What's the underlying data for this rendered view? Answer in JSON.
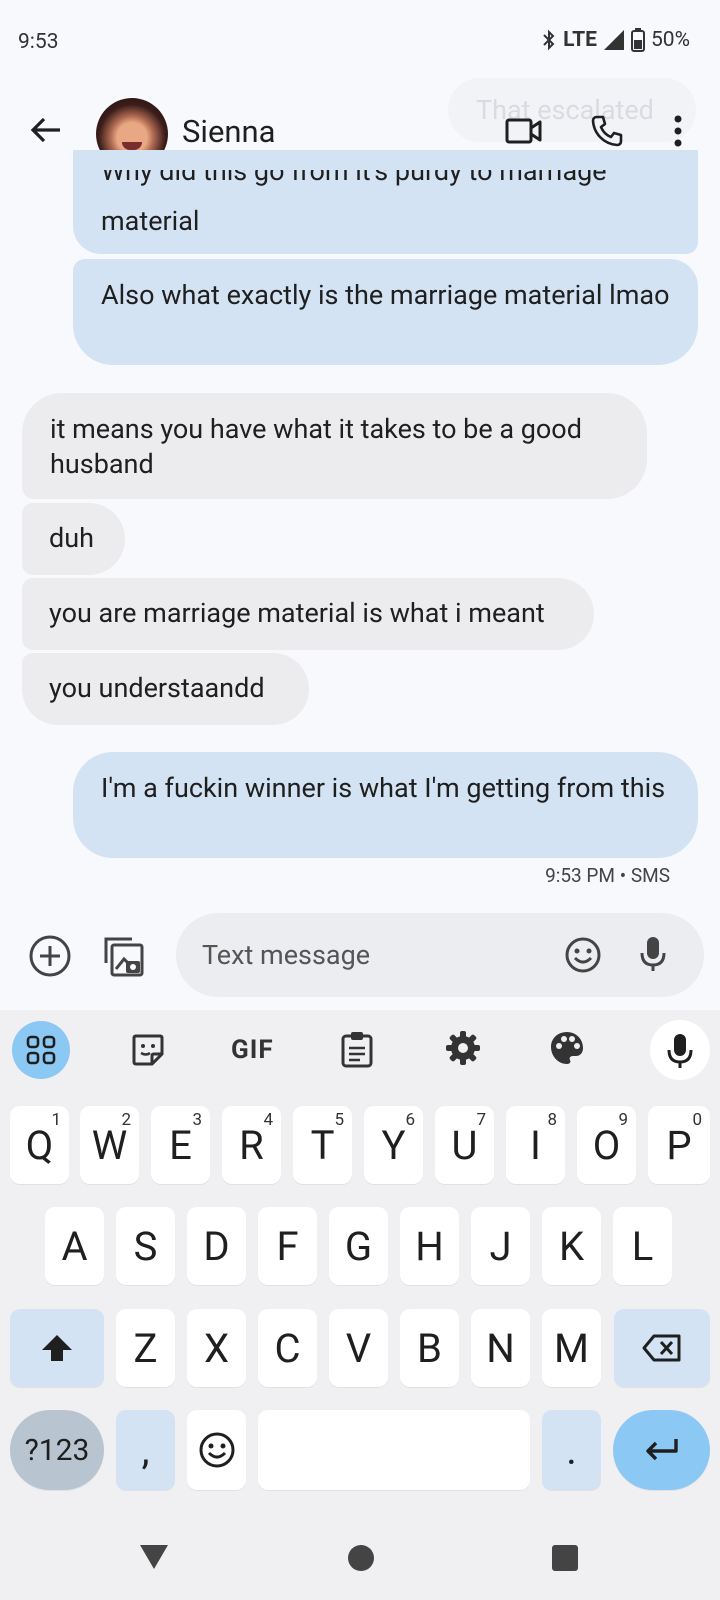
{
  "status_bar": {
    "time": "9:53",
    "network": "LTE",
    "battery": "50%",
    "icons": [
      "bluetooth-icon",
      "signal-icon",
      "battery-icon"
    ]
  },
  "header": {
    "contact_name": "Sienna",
    "ghost_preview": "That escalated",
    "icons": [
      "back-arrow-icon",
      "video-call-icon",
      "phone-icon",
      "more-vert-icon"
    ]
  },
  "messages": [
    {
      "direction": "outgoing",
      "text_line1": "Why did this go from it's purdy to marriage",
      "text_line2": "material"
    },
    {
      "direction": "outgoing",
      "text": "Also what exactly is the marriage material lmao"
    },
    {
      "direction": "incoming",
      "text": "it means you have what it takes to be a good husband"
    },
    {
      "direction": "incoming",
      "text": "duh"
    },
    {
      "direction": "incoming",
      "text": "you are marriage material is what i meant"
    },
    {
      "direction": "incoming",
      "text": "you understaandd"
    },
    {
      "direction": "outgoing",
      "text": "I'm a fuckin winner is what I'm getting from this"
    }
  ],
  "timestamp": "9:53 PM • SMS",
  "compose": {
    "placeholder": "Text message",
    "icons": [
      "add-circle-icon",
      "gallery-icon",
      "emoji-icon",
      "mic-icon"
    ]
  },
  "keyboard": {
    "toolbar": {
      "gif_label": "GIF"
    },
    "row1": [
      {
        "key": "Q",
        "hint": "1"
      },
      {
        "key": "W",
        "hint": "2"
      },
      {
        "key": "E",
        "hint": "3"
      },
      {
        "key": "R",
        "hint": "4"
      },
      {
        "key": "T",
        "hint": "5"
      },
      {
        "key": "Y",
        "hint": "6"
      },
      {
        "key": "U",
        "hint": "7"
      },
      {
        "key": "I",
        "hint": "8"
      },
      {
        "key": "O",
        "hint": "9"
      },
      {
        "key": "P",
        "hint": "0"
      }
    ],
    "row2": [
      "A",
      "S",
      "D",
      "F",
      "G",
      "H",
      "J",
      "K",
      "L"
    ],
    "row3": [
      "Z",
      "X",
      "C",
      "V",
      "B",
      "N",
      "M"
    ],
    "symbols_label": "?123",
    "comma_label": ",",
    "period_label": "."
  },
  "colors": {
    "outgoing_bubble": "#d3e3f4",
    "incoming_bubble": "#ececee",
    "accent": "#8cc8f4",
    "background": "#f8f9fd"
  }
}
